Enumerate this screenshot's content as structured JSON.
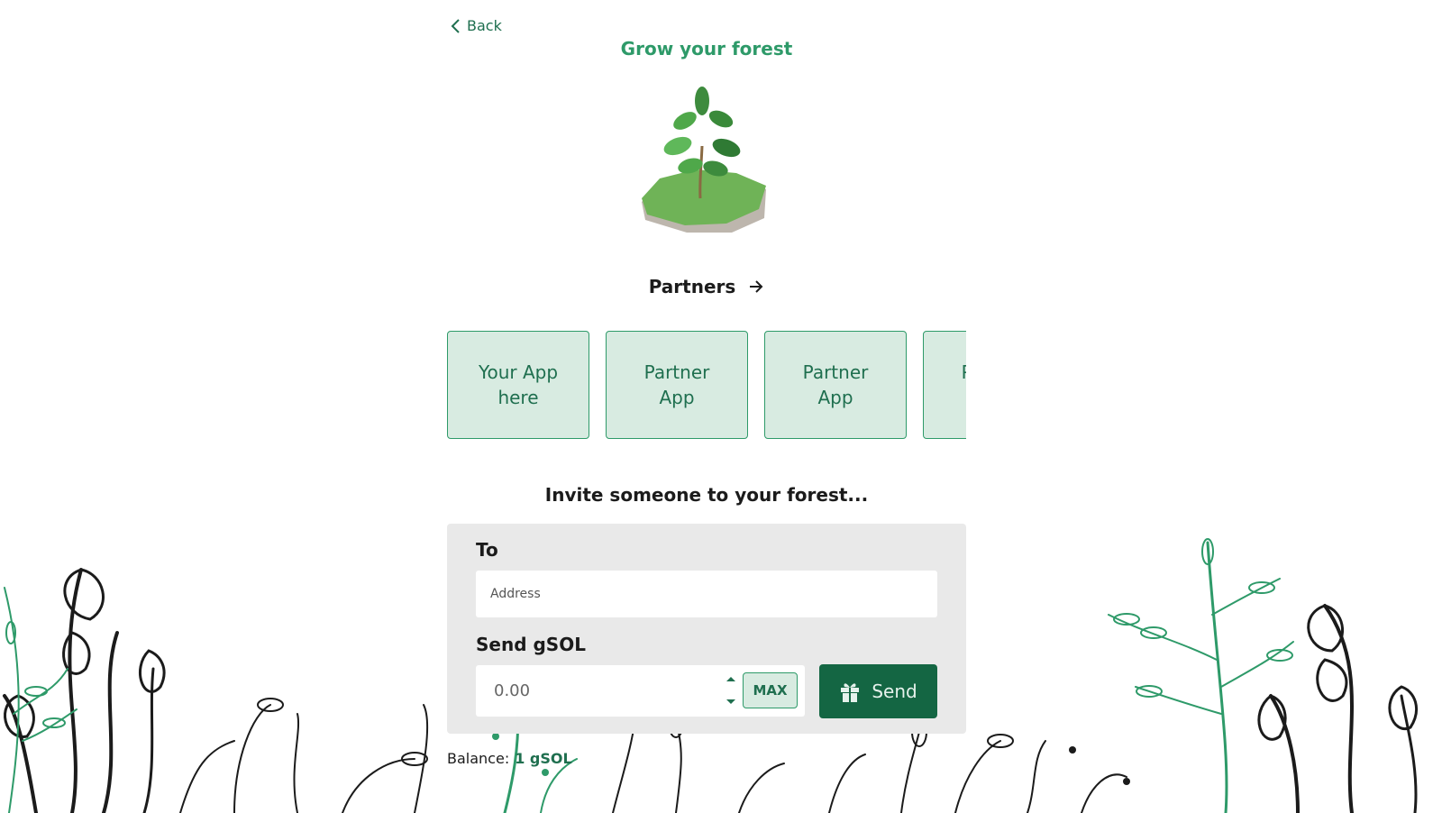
{
  "nav": {
    "back_label": "Back"
  },
  "page": {
    "title": "Grow your forest"
  },
  "partners": {
    "heading": "Partners",
    "cards": [
      {
        "label": "Your App here"
      },
      {
        "label": "Partner App"
      },
      {
        "label": "Partner App"
      },
      {
        "label": "Partner App"
      }
    ]
  },
  "invite": {
    "heading": "Invite someone to your forest...",
    "to_label": "To",
    "address_placeholder": "Address",
    "send_label": "Send gSOL",
    "amount_placeholder": "0.00",
    "max_label": "MAX",
    "send_button_label": "Send"
  },
  "balance": {
    "label": "Balance:",
    "value": "1 gSOL"
  },
  "colors": {
    "brand_green": "#2e9a69",
    "dark_green": "#146643",
    "card_fill": "#d8ebe1",
    "panel_gray": "#e9e9e9"
  },
  "icons": {
    "back": "chevron-left-icon",
    "partners": "arrow-right-icon",
    "send": "gift-icon",
    "tree": "sapling-illustration",
    "background": "foliage-illustration"
  }
}
